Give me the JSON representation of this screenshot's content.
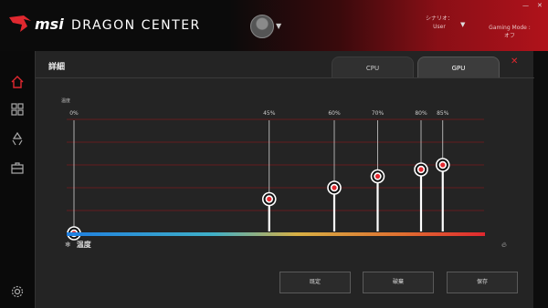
{
  "app": {
    "brand": "msi",
    "name": "DRAGON CENTER"
  },
  "header": {
    "user_line1": "シナリオ：",
    "user_line2": "User",
    "gaming_line1": "Gaming Mode :",
    "gaming_line2": "オフ",
    "win_min": "—",
    "win_close": "✕"
  },
  "colors": {
    "accent": "#e0282f",
    "brand_red": "#b0121b"
  },
  "sidebar": {
    "items": [
      {
        "icon": "home-icon"
      },
      {
        "icon": "grid-icon"
      },
      {
        "icon": "recycle-icon"
      },
      {
        "icon": "toolbox-icon"
      },
      {
        "icon": "gear-icon"
      }
    ]
  },
  "dialog": {
    "title": "詳細",
    "tabs": [
      {
        "label": "CPU",
        "active": false
      },
      {
        "label": "GPU",
        "active": true
      }
    ],
    "close": "✕",
    "temp_label": "温度",
    "buttons": {
      "default": "既定",
      "discard": "破棄",
      "save": "保存"
    }
  },
  "chart_data": {
    "type": "line",
    "ylabel": "温度",
    "xlabel": "温度",
    "tick_labels": [
      "0%",
      "45%",
      "60%",
      "70%",
      "80%",
      "85%"
    ],
    "x": [
      0,
      45,
      60,
      70,
      80,
      85
    ],
    "y": [
      0,
      30,
      40,
      50,
      56,
      60
    ],
    "ylim": [
      0,
      100
    ],
    "grid": true
  }
}
